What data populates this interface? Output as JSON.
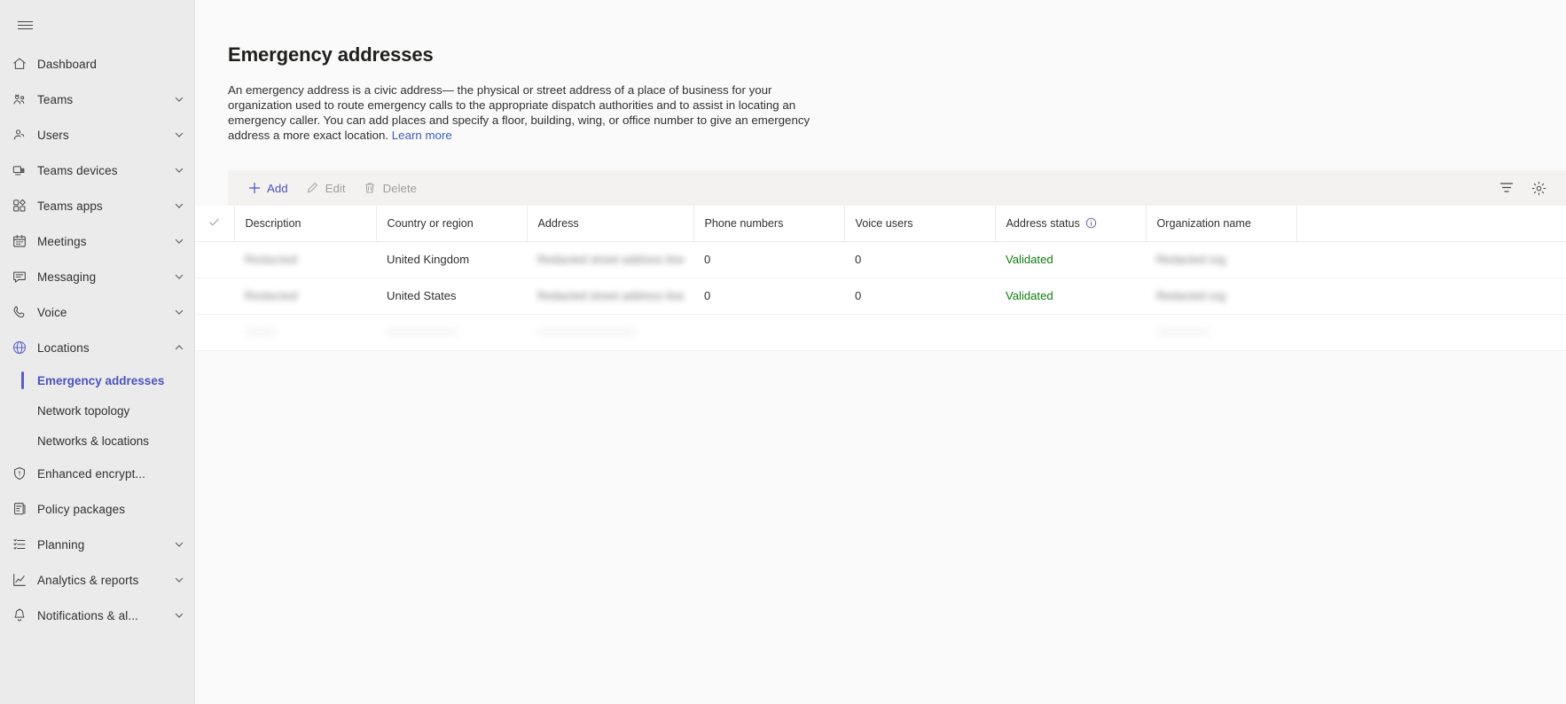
{
  "sidebar": {
    "menu_toggle": "hamburger-menu",
    "items": [
      {
        "label": "Dashboard",
        "icon": "home-icon",
        "expandable": false
      },
      {
        "label": "Teams",
        "icon": "teams-icon",
        "expandable": true
      },
      {
        "label": "Users",
        "icon": "users-icon",
        "expandable": true
      },
      {
        "label": "Teams devices",
        "icon": "devices-icon",
        "expandable": true
      },
      {
        "label": "Teams apps",
        "icon": "apps-icon",
        "expandable": true
      },
      {
        "label": "Meetings",
        "icon": "calendar-icon",
        "expandable": true
      },
      {
        "label": "Messaging",
        "icon": "message-icon",
        "expandable": true
      },
      {
        "label": "Voice",
        "icon": "phone-icon",
        "expandable": true
      },
      {
        "label": "Locations",
        "icon": "globe-icon",
        "expandable": true,
        "expanded": true,
        "active": true
      },
      {
        "label": "Enhanced encrypt...",
        "icon": "shield-icon",
        "expandable": false
      },
      {
        "label": "Policy packages",
        "icon": "package-icon",
        "expandable": false
      },
      {
        "label": "Planning",
        "icon": "planning-icon",
        "expandable": true
      },
      {
        "label": "Analytics & reports",
        "icon": "chart-icon",
        "expandable": true
      },
      {
        "label": "Notifications & al...",
        "icon": "bell-icon",
        "expandable": true
      }
    ],
    "locations_children": [
      {
        "label": "Emergency addresses",
        "selected": true
      },
      {
        "label": "Network topology",
        "selected": false
      },
      {
        "label": "Networks & locations",
        "selected": false
      }
    ]
  },
  "page": {
    "title": "Emergency addresses",
    "description_part1": "An emergency address is a civic address— the physical or street address of a place of business for your organization used to route emergency calls to the appropriate dispatch authorities and to assist in locating an emergency caller. You can add places and specify a floor, building, wing, or office number to give an emergency address a more exact location. ",
    "learn_more": "Learn more"
  },
  "toolbar": {
    "add_label": "Add",
    "edit_label": "Edit",
    "delete_label": "Delete",
    "filter_icon": "filter-icon",
    "settings_icon": "gear-icon"
  },
  "table": {
    "columns": [
      {
        "key": "check",
        "label": ""
      },
      {
        "key": "description",
        "label": "Description"
      },
      {
        "key": "country",
        "label": "Country or region"
      },
      {
        "key": "address",
        "label": "Address"
      },
      {
        "key": "phone_numbers",
        "label": "Phone numbers"
      },
      {
        "key": "voice_users",
        "label": "Voice users"
      },
      {
        "key": "address_status",
        "label": "Address status",
        "info": true
      },
      {
        "key": "organization_name",
        "label": "Organization name"
      }
    ],
    "rows": [
      {
        "description": "Redacted",
        "description_redacted": true,
        "country": "United Kingdom",
        "address": "Redacted street address line",
        "address_redacted": true,
        "phone_numbers": "0",
        "voice_users": "0",
        "address_status": "Validated",
        "organization_name": "Redacted org",
        "organization_redacted": true
      },
      {
        "description": "Redacted",
        "description_redacted": true,
        "country": "United States",
        "address": "Redacted street address line",
        "address_redacted": true,
        "phone_numbers": "0",
        "voice_users": "0",
        "address_status": "Validated",
        "organization_name": "Redacted org",
        "organization_redacted": true
      }
    ]
  },
  "colors": {
    "accent": "#5b5fc7",
    "link": "#3b5bbf",
    "success": "#107c10",
    "sidebar_bg": "#ebebeb",
    "toolbar_bg": "#f3f2f1"
  }
}
